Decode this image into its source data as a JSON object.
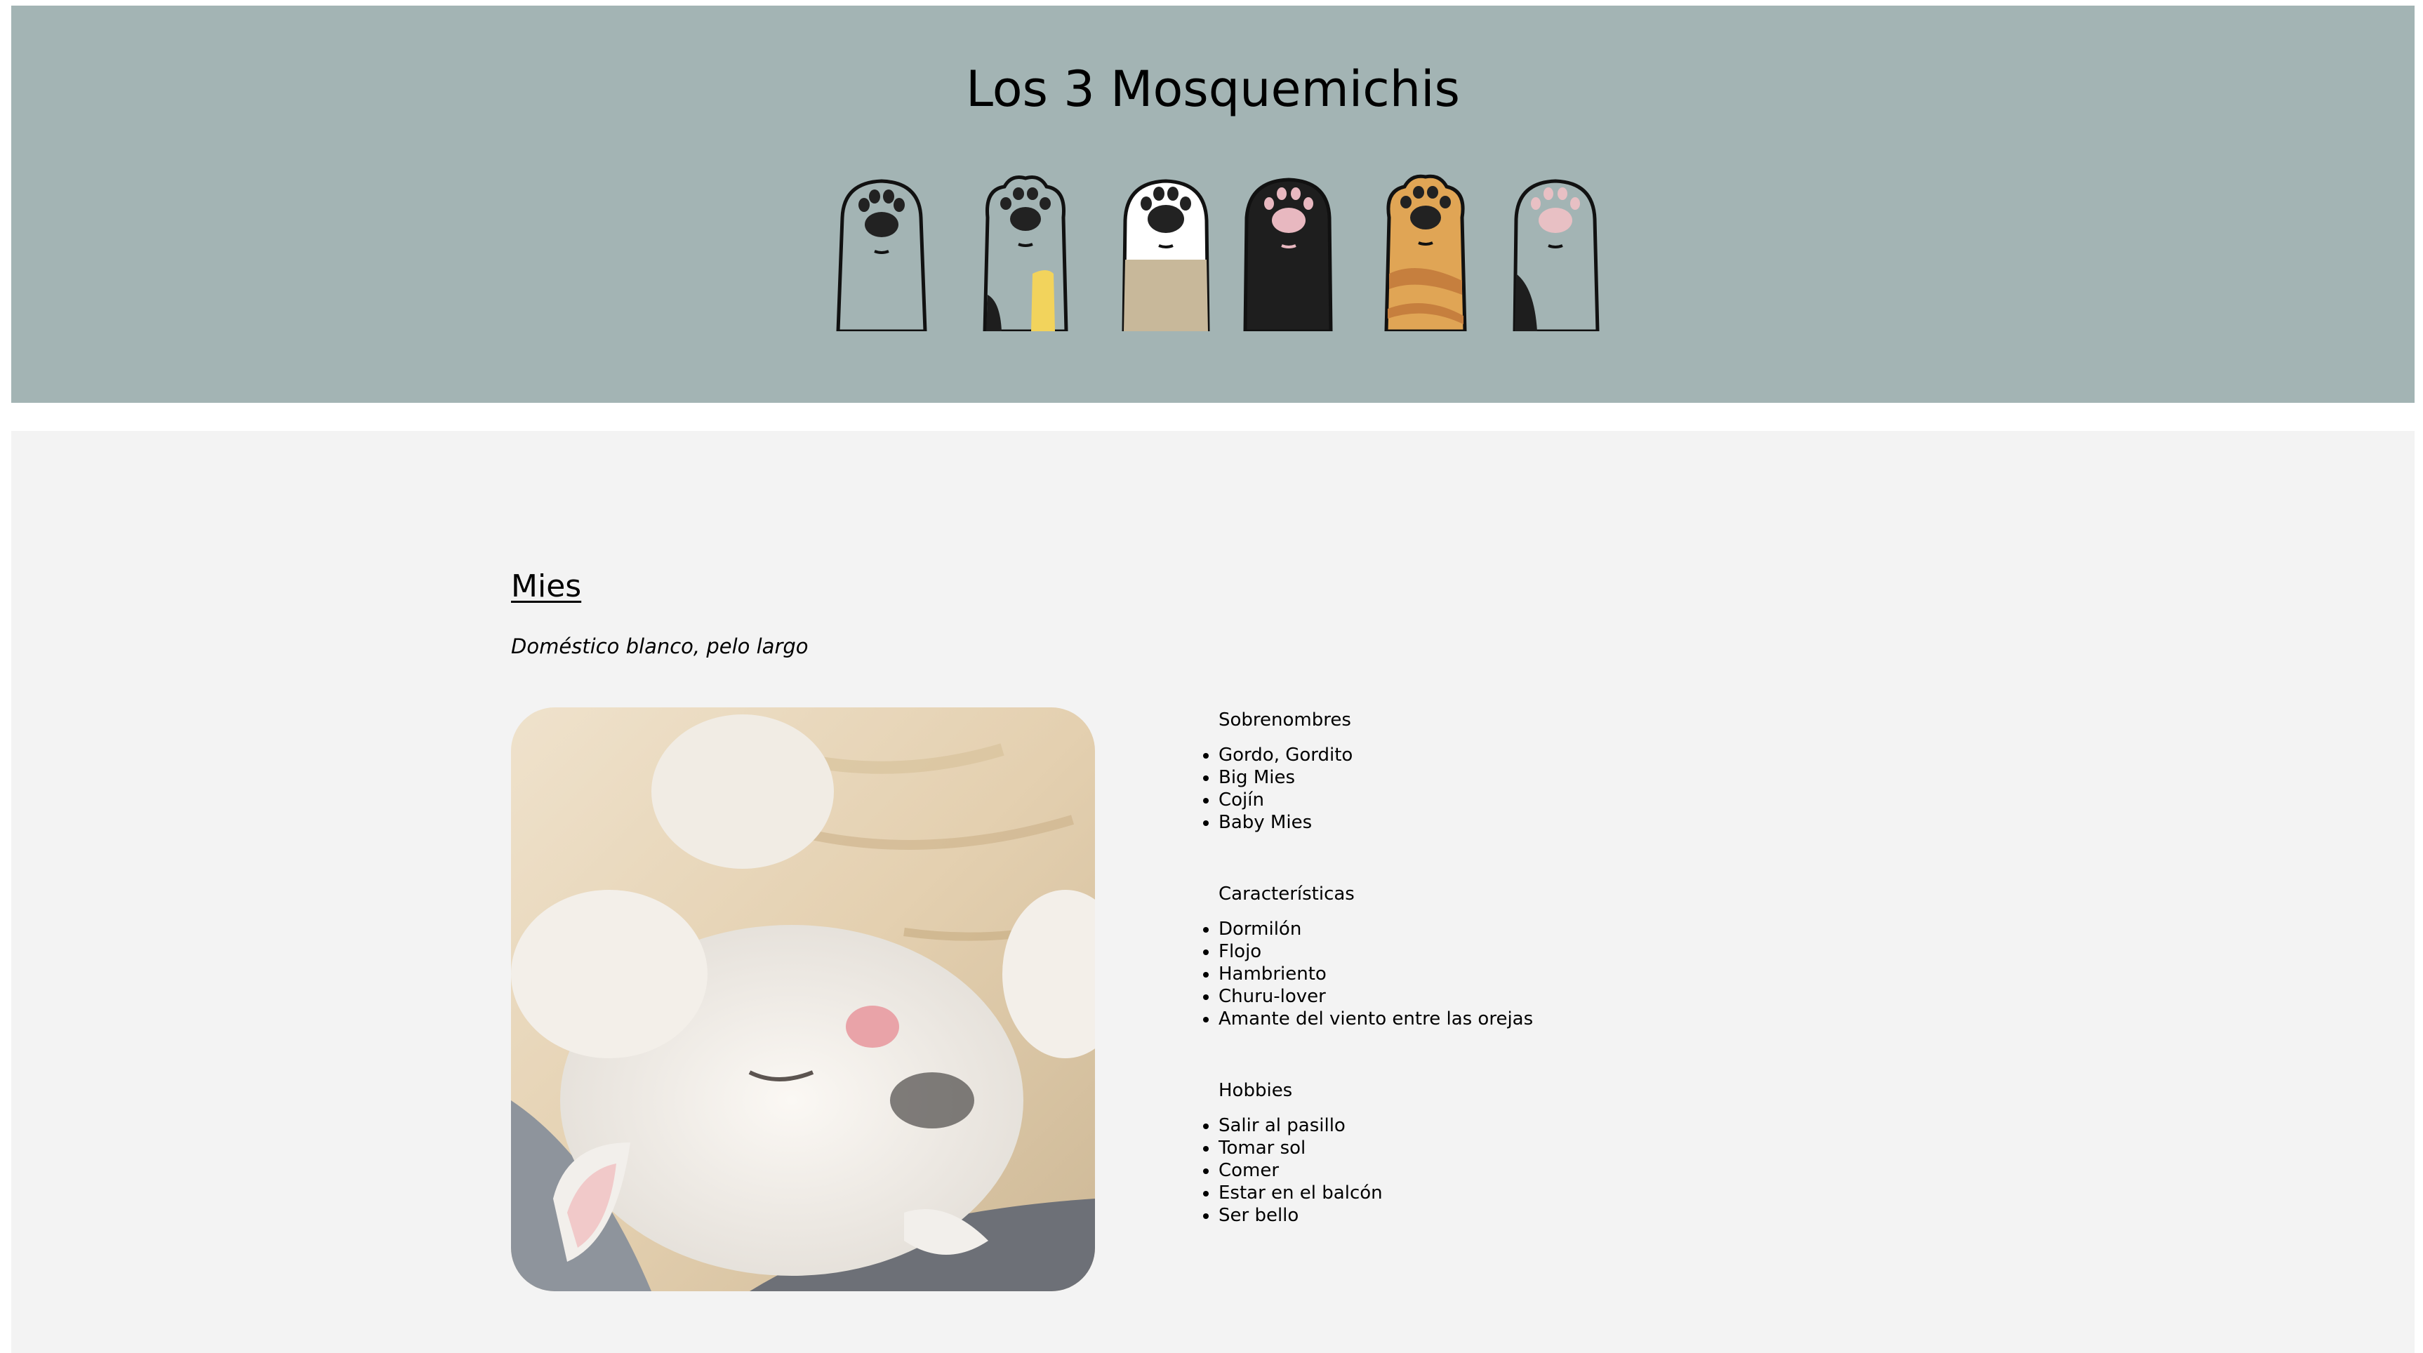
{
  "header": {
    "title": "Los 3 Mosquemichis",
    "paw_icons": [
      {
        "name": "paw-gray-icon",
        "fur": "#a3b4b4",
        "pads": "#222222",
        "patch": ""
      },
      {
        "name": "paw-calico-icon",
        "fur": "#a3b4b4",
        "pads": "#222222",
        "patch": "#f2d35c"
      },
      {
        "name": "paw-white-cream-icon",
        "fur": "#ffffff",
        "pads": "#222222",
        "patch": "#c8b89a"
      },
      {
        "name": "paw-black-icon",
        "fur": "#1e1e1e",
        "pads": "#e8b8c0",
        "patch": ""
      },
      {
        "name": "paw-orange-tabby-icon",
        "fur": "#e0a555",
        "pads": "#222222",
        "patch": "#c67f3e"
      },
      {
        "name": "paw-gray-pink-icon",
        "fur": "#a3b4b4",
        "pads": "#e8c0c4",
        "patch": "#1e1e1e"
      }
    ]
  },
  "cat": {
    "name": "Mies",
    "breed": "Doméstico blanco, pelo largo",
    "photo_icon": "sleeping-white-cat-photo",
    "sections": [
      {
        "heading": "Sobrenombres",
        "items": [
          "Gordo, Gordito",
          "Big Mies",
          "Cojín",
          "Baby Mies"
        ]
      },
      {
        "heading": "Características",
        "items": [
          "Dormilón",
          "Flojo",
          "Hambriento",
          "Churu-lover",
          "Amante del viento entre las orejas"
        ]
      },
      {
        "heading": "Hobbies",
        "items": [
          "Salir al pasillo",
          "Tomar sol",
          "Comer",
          "Estar en el balcón",
          "Ser bello"
        ]
      }
    ]
  },
  "colors": {
    "header_bg": "#a3b4b4",
    "main_bg": "#f3f3f3"
  }
}
